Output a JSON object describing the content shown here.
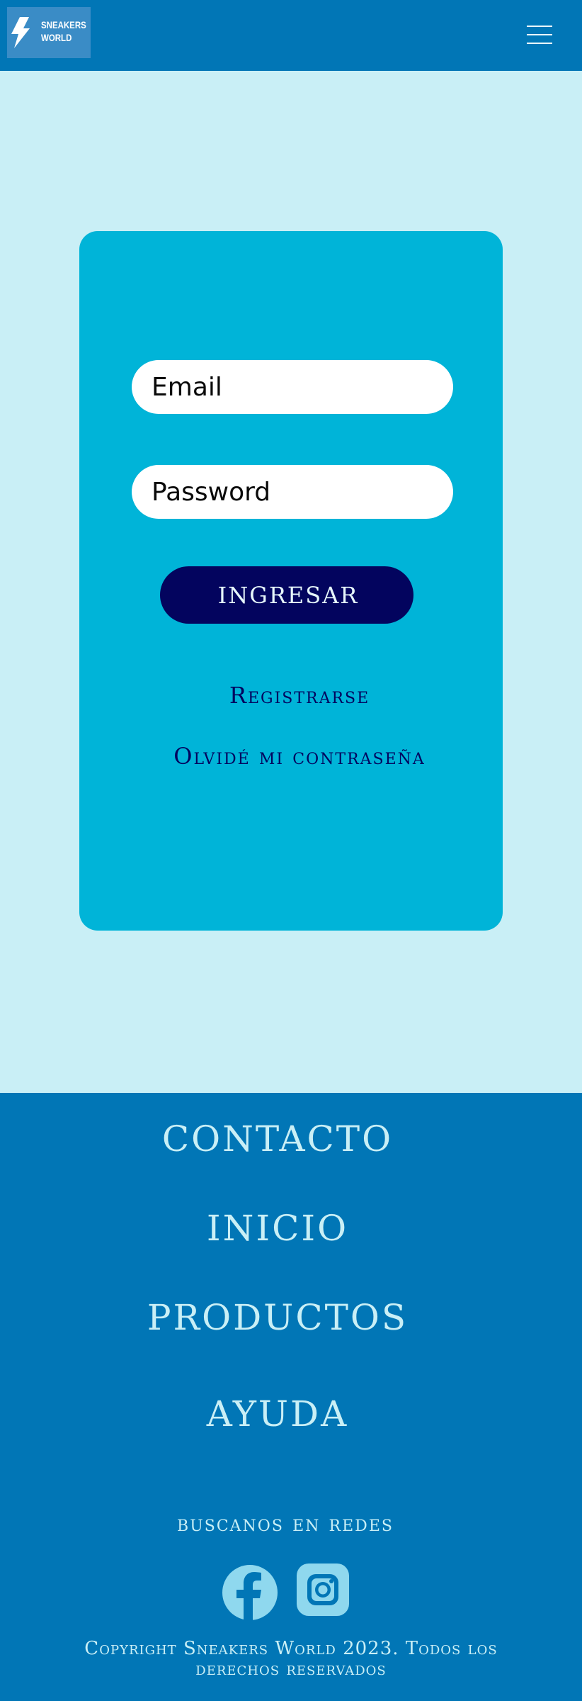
{
  "header": {
    "logo_line1": "SNEAKERS",
    "logo_line2": "WORLD",
    "logo_icon": "lightning-bolt-icon",
    "menu_icon": "hamburger-menu-icon"
  },
  "login": {
    "email_placeholder": "Email",
    "password_placeholder": "Password",
    "submit_label": "INGRESAR",
    "register_link": "Registrarse",
    "forgot_link": "Olvidé mi contraseña"
  },
  "footer": {
    "nav": [
      "CONTACTO",
      "INICIO",
      "PRODUCTOS",
      "AYUDA"
    ],
    "social_title": "buscanos en redes",
    "social_icons": [
      "facebook-icon",
      "instagram-icon"
    ],
    "copyright_line1": "Copyright Sneakers World 2023. Todos los",
    "copyright_line2": "derechos reservados"
  },
  "colors": {
    "page_background": "#c9eff6",
    "header_footer": "#0176b6",
    "card": "#00b4d8",
    "button": "#03045e",
    "link": "#03045e",
    "footer_text": "#c9eff6"
  }
}
